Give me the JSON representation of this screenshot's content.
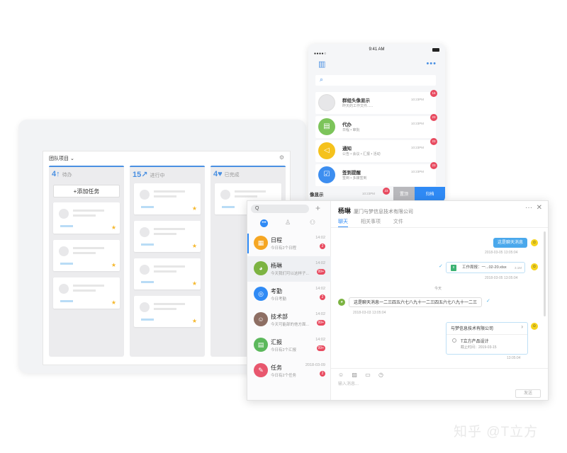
{
  "kanban": {
    "project": "团队项目 ⌄",
    "columns": [
      {
        "count": "4↑",
        "label": "待办",
        "color": "#4a90e2",
        "add_label": "+添加任务"
      },
      {
        "count": "15↗",
        "label": "进行中",
        "color": "#4a90e2"
      },
      {
        "count": "4♥",
        "label": "已完成",
        "color": "#4a90e2"
      }
    ]
  },
  "phone": {
    "time": "9:41 AM",
    "rows": [
      {
        "title": "群组头像显示",
        "sub": "昨天的工作文件......",
        "time": "10:23PM",
        "badge": "16",
        "color": "#e7e7e9",
        "icon": ""
      },
      {
        "title": "代办",
        "sub": "日程 • 审批",
        "time": "10:23PM",
        "badge": "23",
        "color": "#7cc45a",
        "icon": "▤"
      },
      {
        "title": "通知",
        "sub": "公告 • 会议 • 汇报 • 活动",
        "time": "10:23PM",
        "badge": "23",
        "color": "#f5c21c",
        "icon": "◁"
      },
      {
        "title": "签到提醒",
        "sub": "签到 • 多媒签到",
        "time": "10:23PM",
        "badge": "23",
        "color": "#3d8ef0",
        "icon": "☑"
      }
    ],
    "bottom": {
      "label": "像显示",
      "time": "10:23PM",
      "badge": "23",
      "btn1": "置顶",
      "btn2": "归档"
    }
  },
  "chat": {
    "search_placeholder": "Q",
    "list": [
      {
        "name": "日程",
        "sub": "今日有2个日程",
        "time": "14:02",
        "badge": "2",
        "color": "#f5a623",
        "icon": "▦",
        "selected": false,
        "accent": true
      },
      {
        "name": "杨琳",
        "sub": "今天我们可以这样子...",
        "time": "14:02",
        "badge": "99+",
        "color": "#7cb342",
        "icon": "◕",
        "selected": true
      },
      {
        "name": "考勤",
        "sub": "今日考勤",
        "time": "14:02",
        "badge": "2",
        "color": "#2f8af5",
        "icon": "◎",
        "selected": false
      },
      {
        "name": "技术部",
        "sub": "今天可能部的他方面...",
        "time": "14:02",
        "badge": "99+",
        "color": "#8d6e63",
        "icon": "☺",
        "selected": false
      },
      {
        "name": "汇报",
        "sub": "今日有2个汇报",
        "time": "14:02",
        "badge": "99+",
        "color": "#5cb85c",
        "icon": "▤",
        "selected": false
      },
      {
        "name": "任务",
        "sub": "今日有2个任务",
        "time": "2018-03-09",
        "badge": "2",
        "color": "#e8576e",
        "icon": "✎",
        "selected": false
      }
    ],
    "header": {
      "name": "杨琳",
      "company": "厦门与梦信息技术有限公司"
    },
    "tabs": [
      "聊天",
      "相关事项",
      "文件"
    ],
    "messages": {
      "m1": "这是聊天消息",
      "m1_time": "2018-03-05  13:05:04",
      "file_name": "工作周报：一...02-20.xlsx",
      "file_size": "3.1M",
      "m2_time": "2018-03-05  13:05:04",
      "divider": "今天",
      "m3": "这是聊天消息一二三四五六七八九十一二三四五六七八九十一二三",
      "m3_time": "2018-03-03  13:05:04",
      "card_company": "与梦信息技术有限公司",
      "card_project": "T立方产品设计",
      "card_deadline": "截止时间：2019-03-15",
      "m4_time": "13:05:04"
    },
    "input_placeholder": "输入消息...",
    "send_label": "发送"
  },
  "watermark": "知乎 @T立方"
}
